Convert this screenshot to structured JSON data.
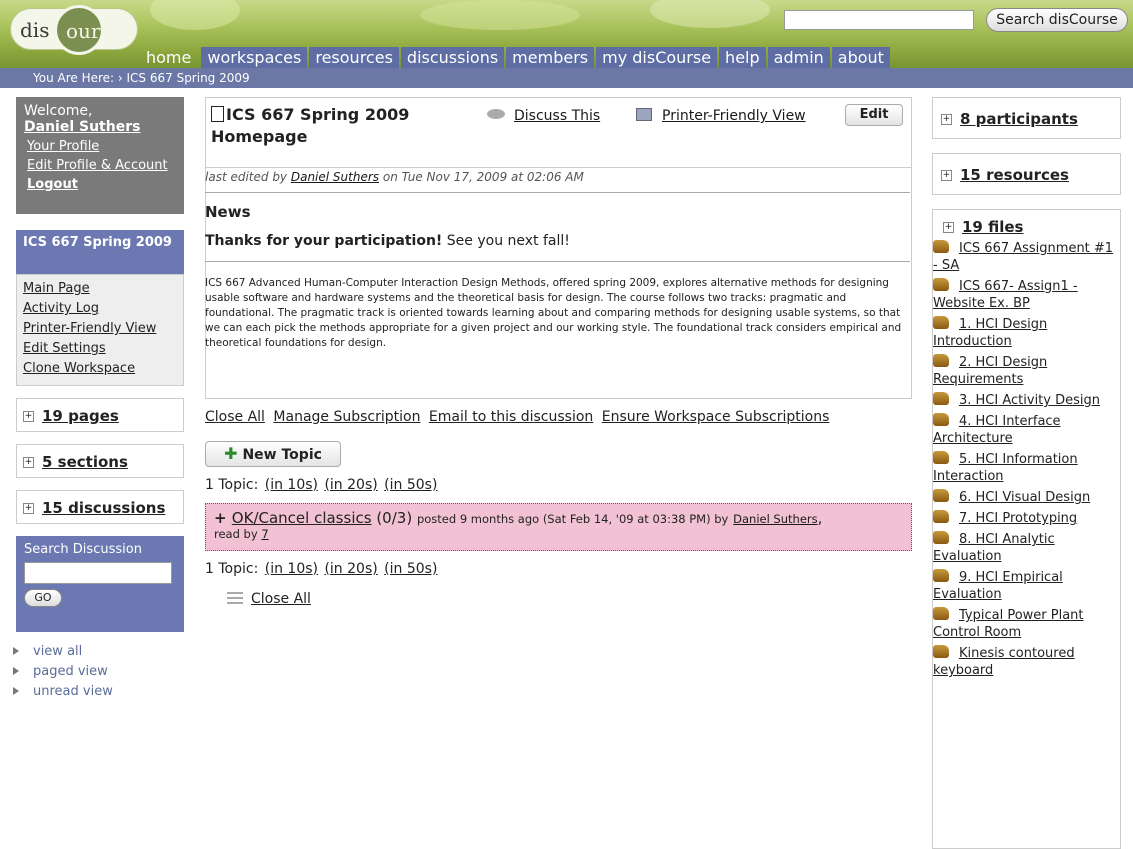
{
  "header": {
    "logo": {
      "part1": "dis",
      "part2": "ourse"
    },
    "search_button": "Search disCourse",
    "search_value": "",
    "nav": [
      "home",
      "workspaces",
      "resources",
      "discussions",
      "members",
      "my disCourse",
      "help",
      "admin",
      "about"
    ],
    "breadcrumb": "You Are Here: › ICS 667 Spring 2009"
  },
  "left": {
    "welcome": "Welcome,",
    "user": "Daniel Suthers",
    "links": [
      "Your Profile",
      "Edit Profile & Account",
      "Logout"
    ],
    "workspace_title": "ICS 667 Spring 2009",
    "workspace_links": [
      "Main Page",
      "Activity Log",
      "Printer-Friendly View",
      "Edit Settings",
      "Clone Workspace"
    ],
    "counts": [
      "19 pages",
      "5 sections",
      "15 discussions"
    ],
    "search_label": "Search Discussion",
    "go": "GO",
    "views": [
      "view all",
      "paged view",
      "unread view"
    ]
  },
  "main": {
    "title": "ICS 667 Spring 2009 Homepage",
    "discuss": "Discuss This",
    "printer": "Printer-Friendly View",
    "edit": "Edit",
    "last_edited_prefix": "last edited by ",
    "last_edited_user": "Daniel Suthers",
    "last_edited_suffix": " on Tue Nov 17, 2009 at 02:06 AM",
    "news_heading": "News",
    "news_bold": "Thanks for your participation!",
    "news_rest": " See you next fall!",
    "description": "ICS 667 Advanced Human-Computer Interaction Design Methods, offered spring 2009, explores alternative methods for designing usable software and hardware systems and the theoretical basis for design. The course follows two tracks: pragmatic and foundational. The pragmatic track is oriented towards learning about and comparing methods for designing usable systems, so that we can each pick the methods appropriate for a given project and our working style. The foundational track considers empirical and theoretical foundations for design.",
    "links": [
      "Close All",
      "Manage Subscription",
      "Email to this discussion",
      "Ensure Workspace Subscriptions"
    ],
    "new_topic": "New Topic",
    "pager": {
      "prefix": "1 Topic:",
      "options": [
        "(in 10s)",
        "(in 20s)",
        "(in 50s)"
      ]
    },
    "topic": {
      "title": "OK/Cancel classics",
      "count": "(0/3)",
      "meta": "posted 9 months ago (Sat Feb 14, '09 at 03:38 PM) by",
      "author": "Daniel Suthers",
      "read_prefix": "read by",
      "read_count": "7"
    },
    "close_all": "Close All"
  },
  "right": {
    "participants": "8 participants",
    "resources": "15 resources",
    "files_label": "19 files",
    "files": [
      "ICS 667 Assignment #1 - SA",
      "ICS 667- Assign1 - Website Ex. BP",
      "1. HCI Design Introduction",
      "2. HCI Design Requirements",
      "3. HCI Activity Design",
      "4. HCI Interface Architecture",
      "5. HCI Information Interaction",
      "6. HCI Visual Design",
      "7. HCI Prototyping",
      "8. HCI Analytic Evaluation",
      "9. HCI Empirical Evaluation",
      "Typical Power Plant Control Room",
      "Kinesis contoured keyboard"
    ]
  }
}
